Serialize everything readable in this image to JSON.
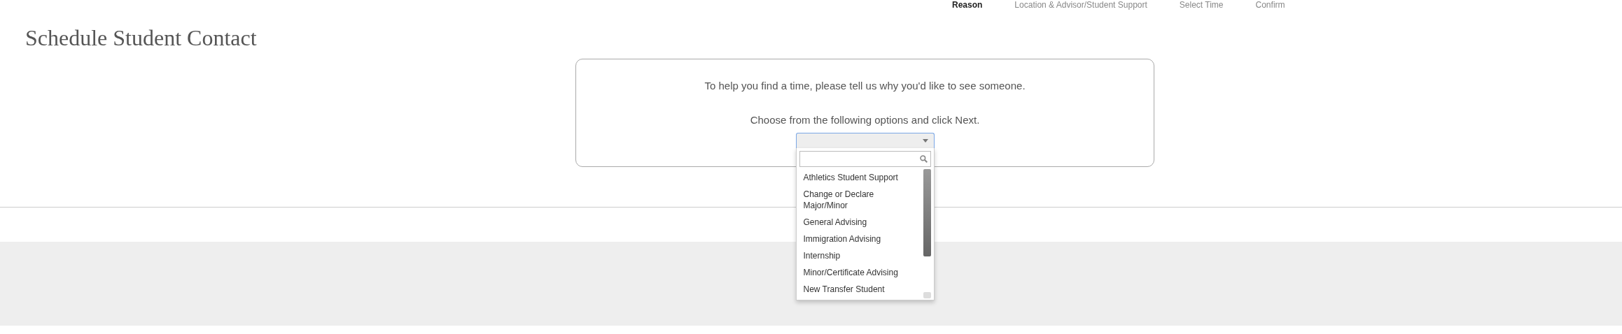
{
  "steps": [
    {
      "label": "Reason",
      "selected": true
    },
    {
      "label": "Location & Advisor/Student Support",
      "selected": false
    },
    {
      "label": "Select Time",
      "selected": false
    },
    {
      "label": "Confirm",
      "selected": false
    }
  ],
  "title": "Schedule Student Contact",
  "intro": "To help you find a time, please tell us why you'd like to see someone.",
  "instruction": "Choose from the following options and click Next.",
  "dropdown": {
    "expanded": true,
    "options": [
      {
        "label": "Athletics Student Support"
      },
      {
        "label": "Change or Declare Major/Minor"
      },
      {
        "label": "General Advising"
      },
      {
        "label": "Immigration Advising"
      },
      {
        "label": "Internship"
      },
      {
        "label": "Minor/Certificate Advising"
      },
      {
        "label": "New Transfer Student"
      }
    ]
  }
}
